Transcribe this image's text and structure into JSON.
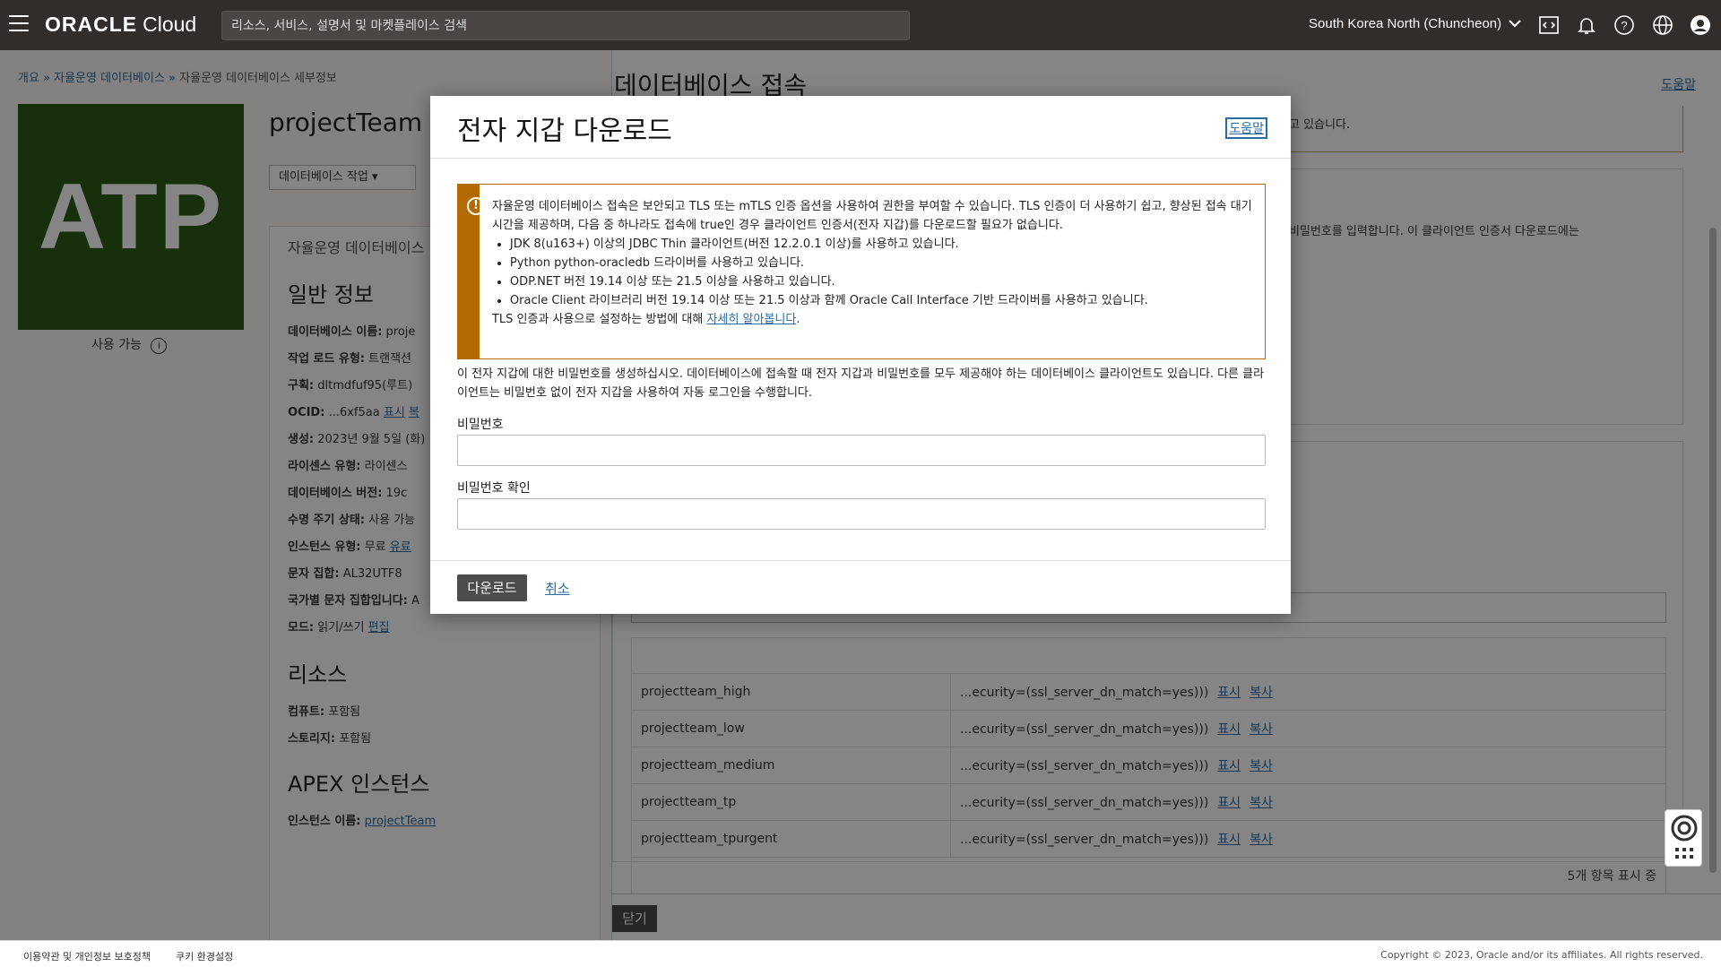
{
  "topbar": {
    "logo_oracle": "ORACLE",
    "logo_cloud": "Cloud",
    "search_placeholder": "리소스, 서비스, 설명서 및 마켓플레이스 검색",
    "region": "South Korea North (Chuncheon)"
  },
  "breadcrumb": {
    "items": [
      "개요",
      "자율운영 데이터베이스"
    ],
    "separator": "»",
    "current": "자율운영 데이터베이스 세부정보"
  },
  "db": {
    "badge": "ATP",
    "status": "사용 가능",
    "name": "projectTeam",
    "action_button": "데이터베이스 작업",
    "tab_title": "자율운영 데이터베이스",
    "general_heading": "일반 정보",
    "rows": [
      {
        "label": "데이터베이스 이름:",
        "value": "proje"
      },
      {
        "label": "작업 로드 유형:",
        "value": "트랜잭션"
      },
      {
        "label": "구획:",
        "value": "dltmdfuf95(루트)"
      },
      {
        "label": "OCID:",
        "value": "...6xf5aa",
        "link1": "표시",
        "link2": "복"
      },
      {
        "label": "생성:",
        "value": "2023년 9월 5일 (화)"
      },
      {
        "label": "라이센스 유형:",
        "value": "라이센스"
      },
      {
        "label": "데이터베이스 버전:",
        "value": "19c"
      },
      {
        "label": "수명 주기 상태:",
        "value": "사용 가능"
      },
      {
        "label": "인스턴스 유형:",
        "value": "무료",
        "link1": "유료"
      },
      {
        "label": "문자 집합:",
        "value": "AL32UTF8"
      },
      {
        "label": "국가별 문자 집합입니다:",
        "value": "A"
      },
      {
        "label": "모드:",
        "value": "읽기/쓰기",
        "link1": "편집"
      }
    ],
    "resources_heading": "리소스",
    "compute": {
      "label": "컴퓨트:",
      "value": "포함됨"
    },
    "storage": {
      "label": "스토리지:",
      "value": "포함됨"
    },
    "apex_heading": "APEX 인스턴스",
    "apex": {
      "label": "인스턴스 이름:",
      "value": "projectTeam"
    }
  },
  "connect_panel": {
    "title": "데이터베이스 접속",
    "help": "도움말",
    "info_text": "고 있습니다.",
    "box_text": "비밀번호를 입력합니다. 이 클라이언트 인증서 다운로드에는",
    "rows": [
      {
        "name": "projectteam_high",
        "conn": "...ecurity=(ssl_server_dn_match=yes)))"
      },
      {
        "name": "projectteam_low",
        "conn": "...ecurity=(ssl_server_dn_match=yes)))"
      },
      {
        "name": "projectteam_medium",
        "conn": "...ecurity=(ssl_server_dn_match=yes)))"
      },
      {
        "name": "projectteam_tp",
        "conn": "...ecurity=(ssl_server_dn_match=yes)))"
      },
      {
        "name": "projectteam_tpurgent",
        "conn": "...ecurity=(ssl_server_dn_match=yes)))"
      }
    ],
    "show_label": "표시",
    "copy_label": "복사",
    "count_text": "5개 항목 표시 중",
    "close_label": "닫기"
  },
  "dialog": {
    "title": "전자 지갑 다운로드",
    "help": "도움말",
    "notice_intro": "자율운영 데이터베이스 접속은 보안되고 TLS 또는 mTLS 인증 옵션을 사용하여 권한을 부여할 수 있습니다. TLS 인증이 더 사용하기 쉽고, 향상된 접속 대기 시간을 제공하며, 다음 중 하나라도 접속에 true인 경우 클라이언트 인증서(전자 지갑)를 다운로드할 필요가 없습니다.",
    "notice_items": [
      "JDK 8(u163+) 이상의 JDBC Thin 클라이언트(버전 12.2.0.1 이상)를 사용하고 있습니다.",
      "Python python-oracledb 드라이버를 사용하고 있습니다.",
      "ODP.NET 버전 19.14 이상 또는 21.5 이상을 사용하고 있습니다.",
      "Oracle Client 라이브러리 버전 19.14 이상 또는 21.5 이상과 함께 Oracle Call Interface 기반 드라이버를 사용하고 있습니다."
    ],
    "notice_outro": "TLS 인증과 사용으로 설정하는 방법에 대해",
    "notice_link": "자세히 알아봅니다",
    "description": "이 전자 지갑에 대한 비밀번호를 생성하십시오. 데이터베이스에 접속할 때 전자 지갑과 비밀번호를 모두 제공해야 하는 데이터베이스 클라이언트도 있습니다. 다른 클라이언트는 비밀번호 없이 전자 지갑을 사용하여 자동 로그인을 수행합니다.",
    "password_label": "비밀번호",
    "confirm_label": "비밀번호 확인",
    "password_value": "",
    "confirm_value": "",
    "download_button": "다운로드",
    "cancel_link": "취소"
  },
  "footer": {
    "terms": "이용약관 및 개인정보 보호정책",
    "cookies": "쿠키 환경설정",
    "copyright": "Copyright © 2023, Oracle and/or its affiliates. All rights reserved."
  },
  "colors": {
    "topbar": "#312d2a",
    "atp_green": "#2d5c16",
    "warning": "#b36a00",
    "link": "#2b6ca3",
    "primary_button": "#4d4c4a"
  }
}
